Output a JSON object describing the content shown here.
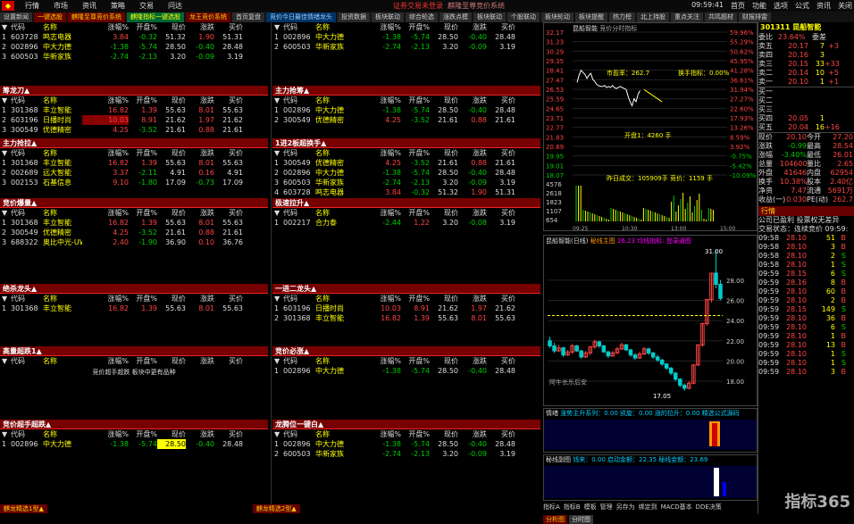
{
  "topbar": {
    "menu": [
      "行情",
      "市场",
      "资讯",
      "策略",
      "交易",
      "问达"
    ],
    "center": "证券交易未登录",
    "center2": "麒隆至尊竞价系统",
    "time": "09:59:41",
    "right": [
      "首页",
      "功能",
      "选项",
      "公式",
      "资讯",
      "关闭"
    ]
  },
  "tabs": [
    {
      "label": "设置新闻",
      "c": ""
    },
    {
      "label": "一键选股",
      "c": "red"
    },
    {
      "label": "麒隆至尊竞价系统",
      "c": "red"
    },
    {
      "label": "麒隆指标一键选股",
      "c": "grn"
    },
    {
      "label": "龙王竞价系统",
      "c": "red"
    },
    {
      "label": "首页复盘",
      "c": ""
    },
    {
      "label": "竞价今日最佳情绪龙头",
      "c": "blu"
    },
    {
      "label": "投资数据",
      "c": ""
    },
    {
      "label": "板块联动",
      "c": ""
    },
    {
      "label": "综合轮选",
      "c": ""
    },
    {
      "label": "涨跌点模",
      "c": ""
    },
    {
      "label": "板块联动",
      "c": ""
    },
    {
      "label": "个股联动",
      "c": ""
    },
    {
      "label": "板块轮动",
      "c": ""
    },
    {
      "label": "板块提醒",
      "c": ""
    },
    {
      "label": "热力榜",
      "c": ""
    },
    {
      "label": "北上持股",
      "c": ""
    },
    {
      "label": "重点关注",
      "c": ""
    },
    {
      "label": "共鸣题材",
      "c": ""
    },
    {
      "label": "财报排雷",
      "c": ""
    }
  ],
  "cols": [
    "代码",
    "名称",
    "涨幅%",
    "开盘%",
    "现价",
    "涨跌",
    "买价"
  ],
  "panels": [
    {
      "title": "",
      "rows": [
        [
          "1",
          "603728",
          "鸣志电器",
          "3.84",
          "-0.32",
          "51.32",
          "1.90",
          "51.31"
        ],
        [
          "2",
          "002896",
          "中大力德",
          "-1.38",
          "-5.74",
          "28.50",
          "-0.40",
          "28.48"
        ],
        [
          "3",
          "600503",
          "华新家族",
          "-2.74",
          "-2.13",
          "3.20",
          "-0.09",
          "3.19"
        ]
      ],
      "namecount": "3"
    },
    {
      "title": "",
      "rows": [
        [
          "1",
          "002896",
          "中大力德",
          "-1.38",
          "-5.74",
          "28.50",
          "-0.40",
          "28.48"
        ],
        [
          "2",
          "600503",
          "华新家族",
          "-2.74",
          "-2.13",
          "3.20",
          "-0.09",
          "3.19"
        ]
      ],
      "namecount": "2"
    },
    {
      "title": "筹龙刀▲",
      "rows": [
        [
          "1",
          "301368",
          "丰立智能",
          "16.82",
          "1.39",
          "55.63",
          "8.01",
          "55.63"
        ],
        [
          "2",
          "603196",
          "日播时尚",
          "10.03",
          "8.91",
          "21.62",
          "1.97",
          "21.62"
        ],
        [
          "3",
          "300549",
          "优德精密",
          "4.25",
          "-3.52",
          "21.61",
          "0.88",
          "21.61"
        ]
      ],
      "namecount": "5"
    },
    {
      "title": "主力抢筹▲",
      "rows": [
        [
          "1",
          "002896",
          "中大力德",
          "-1.38",
          "-5.74",
          "28.50",
          "-0.40",
          "28.48"
        ],
        [
          "2",
          "300549",
          "优德精密",
          "4.25",
          "-3.52",
          "21.61",
          "0.88",
          "21.61"
        ]
      ],
      "namecount": "2"
    },
    {
      "title": "主力抢拉▲",
      "rows": [
        [
          "1",
          "301368",
          "丰立智能",
          "16.82",
          "1.39",
          "55.63",
          "8.01",
          "55.63"
        ],
        [
          "2",
          "002689",
          "远大智能",
          "3.37",
          "-2.11",
          "4.91",
          "0.16",
          "4.91"
        ],
        [
          "3",
          "002153",
          "石基信息",
          "9.10",
          "-1.80",
          "17.09",
          "-0.73",
          "17.09"
        ]
      ],
      "namecount": "3"
    },
    {
      "title": "1进2板超换手▲",
      "rows": [
        [
          "1",
          "300549",
          "优德精密",
          "4.25",
          "-3.52",
          "21.61",
          "0.88",
          "21.61"
        ],
        [
          "2",
          "002896",
          "中大力德",
          "-1.38",
          "-5.74",
          "28.50",
          "-0.40",
          "28.48"
        ],
        [
          "3",
          "600503",
          "华新家族",
          "-2.74",
          "-2.13",
          "3.20",
          "-0.09",
          "3.19"
        ],
        [
          "4",
          "603728",
          "鸣志电器",
          "3.84",
          "-0.32",
          "51.32",
          "1.90",
          "51.31"
        ]
      ],
      "namecount": "4"
    },
    {
      "title": "竞价爆量▲",
      "rows": [
        [
          "1",
          "301368",
          "丰立智能",
          "16.82",
          "1.39",
          "55.63",
          "8.01",
          "55.63"
        ],
        [
          "2",
          "300549",
          "优德精密",
          "4.25",
          "-3.52",
          "21.61",
          "0.88",
          "21.61"
        ],
        [
          "3",
          "688322",
          "奥比中光-UW",
          "2.40",
          "-1.90",
          "36.90",
          "0.10",
          "36.76"
        ]
      ],
      "namecount": "3"
    },
    {
      "title": "极速拉升▲",
      "rows": [
        [
          "1",
          "002217",
          "合力泰",
          "-2.44",
          "1.22",
          "3.20",
          "-0.08",
          "3.19"
        ]
      ],
      "namecount": "1"
    },
    {
      "title": "绝杀龙头▲",
      "rows": [
        [
          "1",
          "301368",
          "丰立智能",
          "16.82",
          "1.39",
          "55.63",
          "8.01",
          "55.63"
        ]
      ],
      "namecount": "1"
    },
    {
      "title": "一进二龙头▲",
      "rows": [
        [
          "1",
          "603196",
          "日播时尚",
          "10.03",
          "8.91",
          "21.62",
          "1.97",
          "21.62"
        ],
        [
          "2",
          "301368",
          "丰立智能",
          "16.82",
          "1.39",
          "55.63",
          "8.01",
          "55.63"
        ]
      ],
      "namecount": "2"
    },
    {
      "title": "高量超跌1▲",
      "rows": [],
      "namecount": "",
      "note": "竞价超手超跌 板块中更有品种"
    },
    {
      "title": "竞价必涨▲",
      "rows": [
        [
          "1",
          "002896",
          "中大力德",
          "-1.38",
          "-5.74",
          "28.50",
          "-0.40",
          "28.48"
        ]
      ],
      "namecount": "1"
    },
    {
      "title": "竞价超手超跌▲",
      "rows": [
        [
          "1",
          "002896",
          "中大力德",
          "-1.38",
          "-5.74",
          "28.50",
          "-0.40",
          "28.48"
        ]
      ],
      "namecount": ""
    },
    {
      "title": "龙腾位一键白▲",
      "rows": [
        [
          "1",
          "002896",
          "中大力德",
          "-1.38",
          "-5.74",
          "28.50",
          "-0.40",
          "28.48"
        ],
        [
          "2",
          "600503",
          "华新家族",
          "-2.74",
          "-2.13",
          "3.20",
          "-0.09",
          "3.19"
        ]
      ],
      "namecount": "2"
    }
  ],
  "bottom": {
    "left": "麒龙精选1型▲",
    "right": "麒龙精选2型▲"
  },
  "intraday": {
    "title": "昆船智能",
    "sub": "竞价分时指标",
    "prices": [
      "32.17",
      "31.23",
      "30.29",
      "29.35",
      "28.41",
      "27.47",
      "26.53",
      "25.59",
      "24.65",
      "23.71",
      "22.77",
      "21.83",
      "20.89",
      "19.95",
      "19.01",
      "18.07"
    ],
    "pct": [
      "59.96%",
      "55.29%",
      "50.62%",
      "45.95%",
      "41.28%",
      "36.61%",
      "31.94%",
      "27.27%",
      "22.60%",
      "17.93%",
      "13.26%",
      "8.59%",
      "3.92%",
      "-0.75%",
      "-5.42%",
      "-10.09%"
    ],
    "vol": [
      "4576",
      "2618",
      "1823",
      "1107",
      "654"
    ],
    "notes": [
      "市盈率：262.7",
      "换手指标：0.00%",
      "开盘1：4260 手",
      "昨日成交：105909手 竞价：1159 手"
    ],
    "times": [
      "09:25",
      "10:30",
      "13:00",
      "15:00"
    ],
    "closes": [
      27.2,
      27.9,
      28.4,
      28.2,
      28.0,
      27.6,
      27.9,
      28.1,
      27.5,
      27.3,
      27.0,
      26.9,
      26.8,
      26.8,
      26.9,
      26.7,
      26.8,
      26.7,
      26.9,
      26.7,
      26.6,
      26.7,
      26.8,
      26.7,
      26.6,
      26.5,
      25.8,
      25.3,
      24.9,
      25.6,
      25.3,
      26.0,
      26.4
    ]
  },
  "kline": {
    "title": "昆船智能(日线)",
    "sub": "秘线主图",
    "extra": "26.23 均线指标: 登录通图",
    "max": "31.00",
    "min": "17.05",
    "axis": [
      "28.00",
      "26.00",
      "24.00",
      "22.00",
      "20.00",
      "18.00"
    ],
    "note": "阿牛长乐后安",
    "data": [
      [
        22,
        21.5,
        22.4,
        21.3
      ],
      [
        21.5,
        21,
        21.8,
        20.8
      ],
      [
        21,
        21.3,
        21.6,
        20.9
      ],
      [
        21.3,
        20.6,
        21.4,
        20.4
      ],
      [
        20.6,
        20.9,
        21.1,
        20.5
      ],
      [
        20.9,
        21.5,
        21.7,
        20.7
      ],
      [
        21.5,
        21,
        21.6,
        20.9
      ],
      [
        21,
        20.4,
        21.1,
        20.2
      ],
      [
        20.4,
        20.8,
        21,
        20.3
      ],
      [
        20.8,
        21.4,
        21.5,
        20.6
      ],
      [
        21.4,
        21.9,
        22.1,
        21.2
      ],
      [
        21.9,
        21.5,
        22,
        21.3
      ],
      [
        21.5,
        20.9,
        21.6,
        20.8
      ],
      [
        20.9,
        20.5,
        21,
        20.3
      ],
      [
        20.5,
        20.8,
        21,
        20.4
      ],
      [
        20.8,
        21.2,
        21.4,
        20.7
      ],
      [
        21.2,
        21.6,
        21.8,
        21.1
      ],
      [
        21.6,
        21.1,
        21.7,
        21
      ],
      [
        21.1,
        20.6,
        21.2,
        20.4
      ],
      [
        20.6,
        20.3,
        20.8,
        20.1
      ],
      [
        20.3,
        20.7,
        20.9,
        20.2
      ],
      [
        20.7,
        21.2,
        21.4,
        20.6
      ],
      [
        21.2,
        20.8,
        21.3,
        20.6
      ],
      [
        20.8,
        20.4,
        20.9,
        20.2
      ],
      [
        20.4,
        20.1,
        20.6,
        19.9
      ],
      [
        20.1,
        19.7,
        20.2,
        19.5
      ],
      [
        19.7,
        19.3,
        19.8,
        19.1
      ],
      [
        19.3,
        18.8,
        19.4,
        18.6
      ],
      [
        18.8,
        18.2,
        18.9,
        18
      ],
      [
        18.2,
        17.6,
        18.3,
        17.4
      ],
      [
        17.6,
        17.3,
        17.8,
        17.05
      ],
      [
        17.3,
        17.8,
        18,
        17.2
      ],
      [
        17.8,
        19.6,
        19.7,
        17.7
      ],
      [
        19.6,
        21.6,
        21.6,
        19.5
      ],
      [
        21.6,
        23.7,
        23.8,
        21.4
      ],
      [
        23.7,
        26.1,
        26.1,
        23.5
      ],
      [
        26.1,
        28.7,
        28.7,
        25.8
      ],
      [
        28.7,
        27.6,
        31,
        27.2
      ],
      [
        27.6,
        26.2,
        28,
        26
      ]
    ]
  },
  "ind1": {
    "title": "情绪",
    "items": "涨势主升系列：0.00  凯旋：0.00  涨的拉升：0.00  精选公式源码"
  },
  "ind2": {
    "title": "秘线副图",
    "items": "钱来：0.00  启动金额：22.35  秘线金额：23.69"
  },
  "tabs_bottom": [
    "指标A",
    "指标B",
    "模板",
    "管理",
    "另存为",
    "绑定到",
    "MACD基本",
    "DDE决策"
  ],
  "bottom_right": [
    "分析图",
    "分时图"
  ],
  "quote": {
    "code": "301311",
    "name": "昆船智能",
    "wb_lbl": "委比",
    "wb": "23.64%",
    "wc_lbl": "委差",
    "wc": "",
    "asks": [
      [
        "卖五",
        "20.17",
        "7",
        "+3"
      ],
      [
        "卖四",
        "20.16",
        "3",
        ""
      ],
      [
        "卖三",
        "20.15",
        "33",
        "+33"
      ],
      [
        "卖二",
        "20.14",
        "10",
        "+5"
      ],
      [
        "卖一",
        "20.10",
        "1",
        "+1"
      ]
    ],
    "bids": [
      [
        "买一",
        "",
        "",
        ""
      ],
      [
        "买二",
        "",
        "",
        ""
      ],
      [
        "买三",
        "",
        "",
        ""
      ],
      [
        "买四",
        "20.05",
        "1",
        ""
      ],
      [
        "买五",
        "20.04",
        "16",
        "+16"
      ]
    ],
    "stats": [
      [
        "现价",
        "20.10",
        "今开",
        "27.20"
      ],
      [
        "涨跌",
        "-0.99",
        "最高",
        "28.54"
      ],
      [
        "涨幅",
        "-3.40%",
        "最低",
        "26.01"
      ],
      [
        "总量",
        "104600",
        "量比",
        "2.65"
      ],
      [
        "外盘",
        "41646",
        "内盘",
        "62954"
      ],
      [
        "换手",
        "10.38%",
        "股本",
        "2.40亿"
      ],
      [
        "净资",
        "7.47",
        "流通",
        "5691万"
      ],
      [
        "收益(一)",
        "0.030",
        "PE(动)",
        "262.7"
      ]
    ],
    "ticks_title": "行情",
    "ticks_sub": "公司已盈利 投票权无差异",
    "ticks_sub2": "交易状态：连续竞价",
    "ticks_time": "09:59:",
    "ticks": [
      [
        "09:58",
        "28.10",
        "51",
        "B"
      ],
      [
        "09:58",
        "28.10",
        "3",
        "B"
      ],
      [
        "09:58",
        "28.10",
        "2",
        "S"
      ],
      [
        "09:58",
        "28.10",
        "1",
        "S"
      ],
      [
        "09:59",
        "28.15",
        "6",
        "S"
      ],
      [
        "09:59",
        "28.16",
        "8",
        "B"
      ],
      [
        "09:59",
        "28.10",
        "60",
        "B"
      ],
      [
        "09:59",
        "28.10",
        "2",
        "B"
      ],
      [
        "09:59",
        "28.15",
        "149",
        "S"
      ],
      [
        "09:59",
        "28.10",
        "36",
        "B"
      ],
      [
        "09:59",
        "28.10",
        "6",
        "S"
      ],
      [
        "09:59",
        "28.10",
        "1",
        "B"
      ],
      [
        "09:59",
        "28.10",
        "13",
        "B"
      ],
      [
        "09:59",
        "28.10",
        "1",
        "S"
      ],
      [
        "09:59",
        "28.10",
        "1",
        "S"
      ],
      [
        "09:59",
        "28.10",
        "3",
        "B"
      ]
    ]
  },
  "watermark": "指标365"
}
